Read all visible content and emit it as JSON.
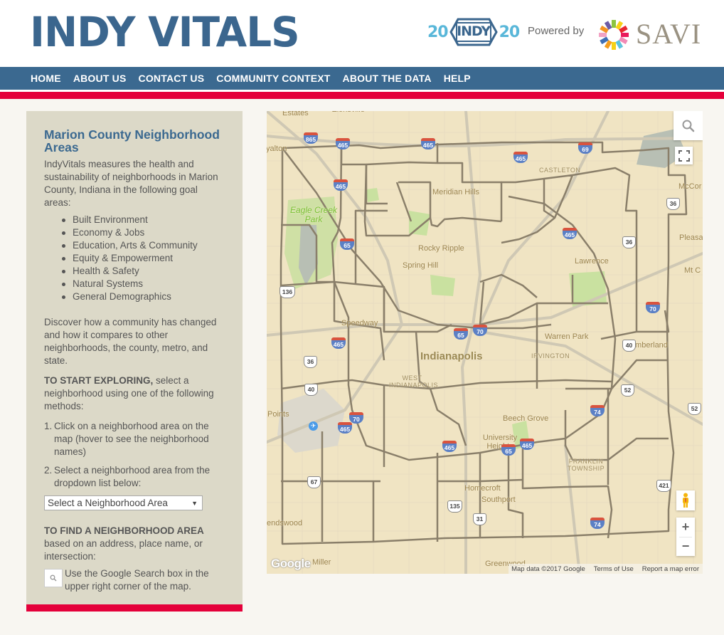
{
  "header": {
    "site_title": "INDY VITALS",
    "logo_2020": {
      "left": "20",
      "center": "INDY",
      "right": "20"
    },
    "powered_by": "Powered by",
    "savi_logo": "SAVI"
  },
  "nav": {
    "items": [
      "HOME",
      "ABOUT US",
      "CONTACT US",
      "COMMUNITY CONTEXT",
      "ABOUT THE DATA",
      "HELP"
    ]
  },
  "colors": {
    "brand_blue": "#3b6990",
    "accent_red": "#e4003a",
    "sidebar_bg": "#dcd9c8",
    "map_bg": "#f0e4c3",
    "boundary": "#8a7f6a"
  },
  "sidebar": {
    "title": "Marion County Neighborhood Areas",
    "intro": "IndyVitals measures the health and sustainability of neighborhoods in Marion County, Indiana in the following goal areas:",
    "goal_areas": [
      "Built Environment",
      "Economy & Jobs",
      "Education, Arts & Community",
      "Equity & Empowerment",
      "Health & Safety",
      "Natural Systems",
      "General Demographics"
    ],
    "discover": "Discover how a community has changed and how it compares to other neighborhoods, the county, metro, and state.",
    "start_bold": "TO START EXPLORING,",
    "start_rest": " select a neighborhood using one of the following methods:",
    "methods": [
      {
        "num": "1.",
        "text": "Click on a neighborhood area on the map (hover to see the neighborhood names)"
      },
      {
        "num": "2.",
        "text": "Select a neighborhood area from the dropdown list below:"
      }
    ],
    "select": {
      "selected": "Select a Neighborhood Area",
      "arrow": "▼"
    },
    "find_title": "TO FIND A NEIGHBORHOOD AREA",
    "find_text": "based on an address, place name, or intersection:",
    "search_hint": "Use the Google Search box in the upper right corner of the map."
  },
  "map": {
    "labels": {
      "estates": "Estates",
      "zionsville": "Zionsville",
      "royalton": "yalton",
      "eagle_creek": "Eagle Creek Park",
      "meridian_hills": "Meridian Hills",
      "castleton": "CASTLETON",
      "mccordsville": "McCor",
      "rocky_ripple": "Rocky Ripple",
      "spring_hill": "Spring Hill",
      "lawrence": "Lawrence",
      "pleasant": "Pleasa",
      "mt_comfort": "Mt C",
      "speedway": "Speedway",
      "indianapolis": "Indianapolis",
      "west_indianapolis": "WEST INDIANAPOLIS",
      "warren_park": "Warren Park",
      "irvington": "IRVINGTON",
      "cumberland": "Cumberland",
      "points": "Points",
      "beech_grove": "Beech Grove",
      "university_heights": "University Heights",
      "franklin_township": "FRANKLIN TOWNSHIP",
      "homecroft": "Homecroft",
      "southport": "Southport",
      "friendswood": "endswood",
      "miller": "Miller",
      "greenwood": "Greenwood"
    },
    "interstates": {
      "i865": "865",
      "i465": "465",
      "i69": "69",
      "i65": "65",
      "i70": "70",
      "i74": "74"
    },
    "us_routes": {
      "us36": "36",
      "us136": "136",
      "us40": "40",
      "us52": "52",
      "us67": "67",
      "us135": "135",
      "us31": "31",
      "us421": "421"
    },
    "controls": {
      "zoom_in": "+",
      "zoom_out": "−"
    },
    "google_logo": "Google",
    "attribution": {
      "map_data": "Map data ©2017 Google",
      "terms": "Terms of Use",
      "report": "Report a map error"
    }
  }
}
